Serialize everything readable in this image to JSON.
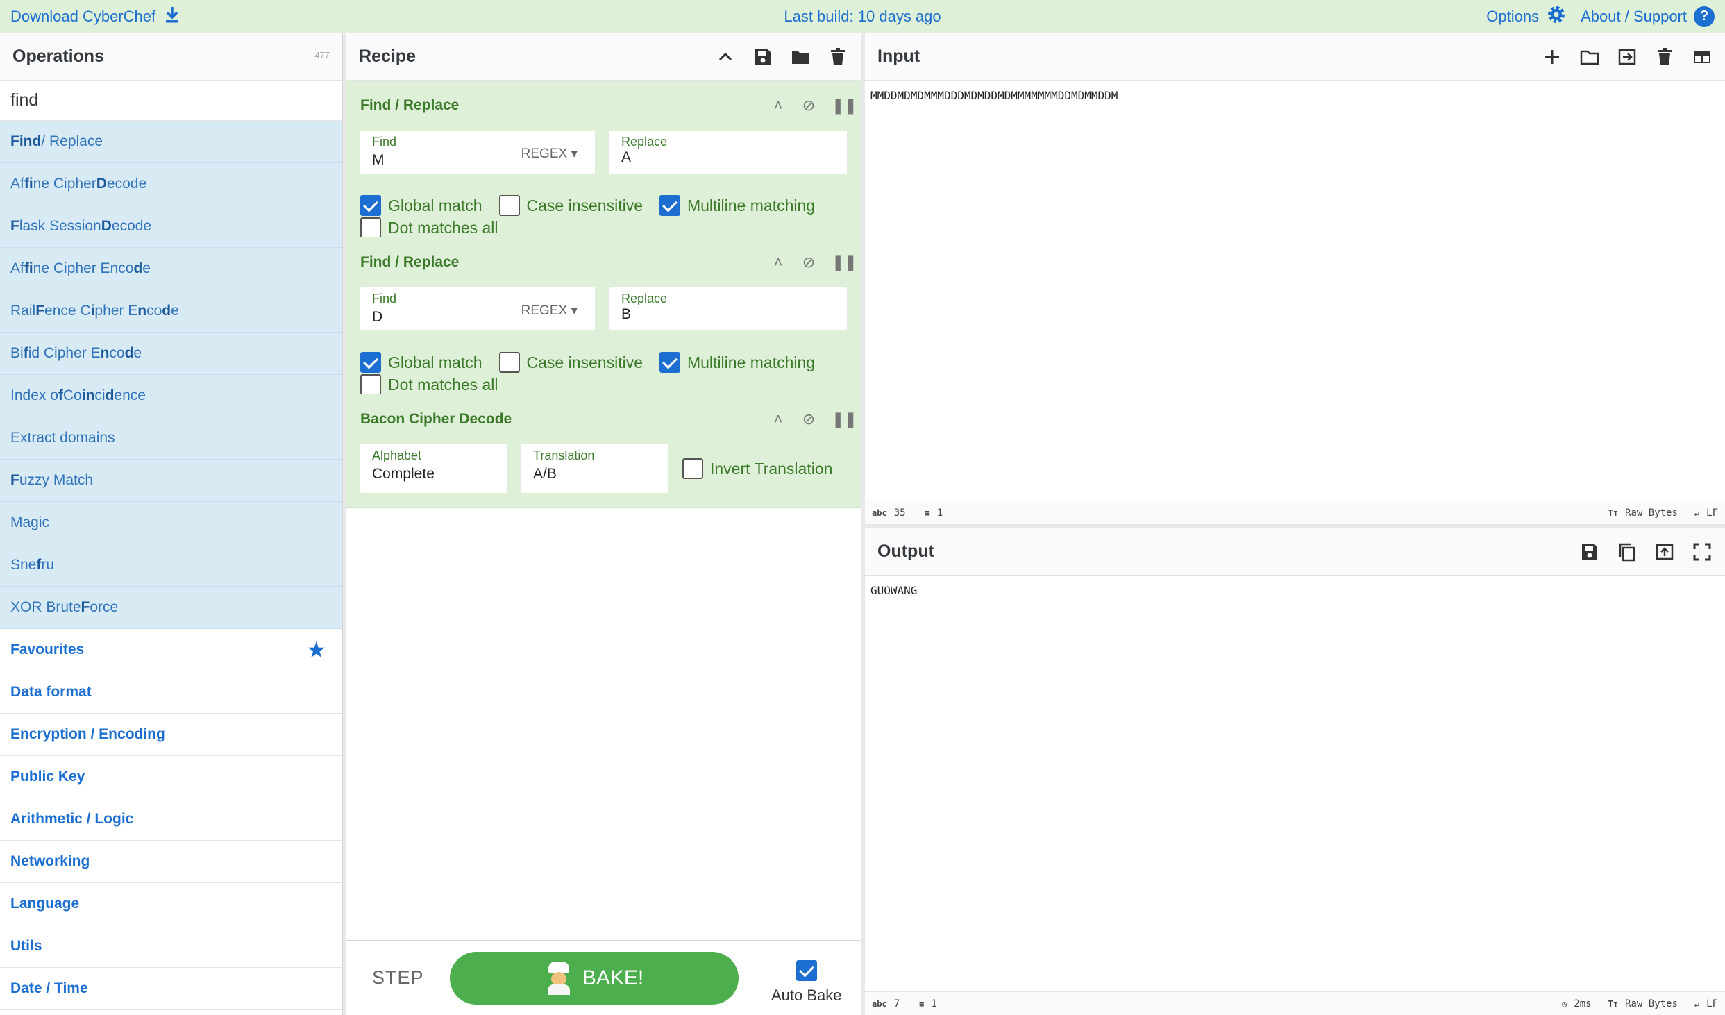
{
  "banner": {
    "download": "Download CyberChef",
    "last_build": "Last build: 10 days ago",
    "options": "Options",
    "about": "About / Support"
  },
  "operations": {
    "title": "Operations",
    "count": "477",
    "search_value": "find",
    "results": [
      {
        "pre": "",
        "bold": "Find",
        "post": " / Replace"
      },
      {
        "html": "Af<b>fi</b>ne Cipher <b>D</b>ecode"
      },
      {
        "html": "<b>F</b>lask Session <b>D</b>ecode"
      },
      {
        "html": "Af<b>fi</b>ne Cipher Enco<b>d</b>e"
      },
      {
        "html": "Rail <b>F</b>ence C<b>i</b>pher E<b>n</b>co<b>d</b>e"
      },
      {
        "html": "Bi<b>f</b>id Cipher E<b>n</b>co<b>d</b>e"
      },
      {
        "html": "Index o<b>f</b> Co<b>in</b>ci<b>d</b>ence"
      },
      {
        "html": "Extract domains"
      },
      {
        "html": "<b>F</b>uzzy Match"
      },
      {
        "html": "Magic"
      },
      {
        "html": "Sne<b>f</b>ru"
      },
      {
        "html": "XOR Brute <b>F</b>orce"
      }
    ],
    "result_labels": [
      "Find / Replace",
      "Affine Cipher Decode",
      "Flask Session Decode",
      "Affine Cipher Encode",
      "Rail Fence Cipher Encode",
      "Bifid Cipher Encode",
      "Index of Coincidence",
      "Extract domains",
      "Fuzzy Match",
      "Magic",
      "Snefru",
      "XOR Brute Force"
    ],
    "categories": [
      "Favourites",
      "Data format",
      "Encryption / Encoding",
      "Public Key",
      "Arithmetic / Logic",
      "Networking",
      "Language",
      "Utils",
      "Date / Time"
    ]
  },
  "recipe": {
    "title": "Recipe",
    "ops": [
      {
        "name": "Find / Replace",
        "find_label": "Find",
        "find_value": "M",
        "find_type": "REGEX",
        "replace_label": "Replace",
        "replace_value": "A",
        "global": "Global match",
        "case": "Case insensitive",
        "multiline": "Multiline matching",
        "dotall": "Dot matches all"
      },
      {
        "name": "Find / Replace",
        "find_label": "Find",
        "find_value": "D",
        "find_type": "REGEX",
        "replace_label": "Replace",
        "replace_value": "B",
        "global": "Global match",
        "case": "Case insensitive",
        "multiline": "Multiline matching",
        "dotall": "Dot matches all"
      },
      {
        "name": "Bacon Cipher Decode",
        "alphabet_label": "Alphabet",
        "alphabet_value": "Complete",
        "translation_label": "Translation",
        "translation_value": "A/B",
        "invert": "Invert Translation"
      }
    ],
    "step": "STEP",
    "bake": "BAKE!",
    "autobake": "Auto Bake"
  },
  "input": {
    "title": "Input",
    "text": "MMDDMDMDMMMDDDMDMDDMDMMMMMMMDDMDMMDDM",
    "length": "35",
    "lines": "1",
    "encoding": "Raw Bytes",
    "eol": "LF"
  },
  "output": {
    "title": "Output",
    "text": "GUOWANG",
    "length": "7",
    "lines": "1",
    "time": "2ms",
    "encoding": "Raw Bytes",
    "eol": "LF"
  },
  "colors": {
    "accent": "#1c6fd1",
    "recipe_bg": "#dff0d8",
    "op_highlight": "#d8ebf5",
    "bake_green": "#4cae4c"
  }
}
